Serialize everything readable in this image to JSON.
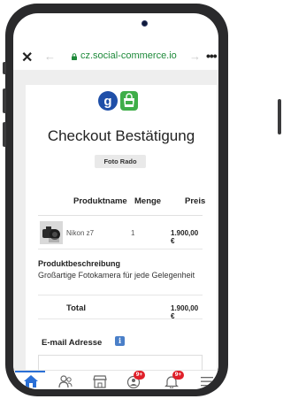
{
  "browser": {
    "close_label": "✕",
    "back_label": "←",
    "url": "cz.social-commerce.io",
    "forward_label": "→",
    "more_label": "•••"
  },
  "page": {
    "title": "Checkout Bestätigung",
    "shop_name": "Foto Rado"
  },
  "table": {
    "headers": [
      "Produktname",
      "Menge",
      "Preis"
    ],
    "rows": [
      {
        "name": "Nikon z7",
        "qty": "1",
        "price": "1.900,00 €"
      }
    ]
  },
  "description": {
    "heading": "Produktbeschreibung",
    "text": "Großartige Fotokamera für jede Gelegenheit"
  },
  "total": {
    "label": "Total",
    "value": "1.900,00 €"
  },
  "email": {
    "label": "E-mail Adresse",
    "info": "i",
    "value": ""
  },
  "tabbar": {
    "items": [
      {
        "icon": "home-icon"
      },
      {
        "icon": "people-icon"
      },
      {
        "icon": "store-icon"
      },
      {
        "icon": "messages-icon",
        "badge": "9+"
      },
      {
        "icon": "notifications-icon",
        "badge": "9+"
      },
      {
        "icon": "menu-icon"
      }
    ]
  },
  "colors": {
    "accent": "#2a6fd6",
    "badge": "#e0202a",
    "url_green": "#1e8a3a",
    "logo_blue": "#1f4fa8",
    "logo_green": "#3fae49"
  }
}
